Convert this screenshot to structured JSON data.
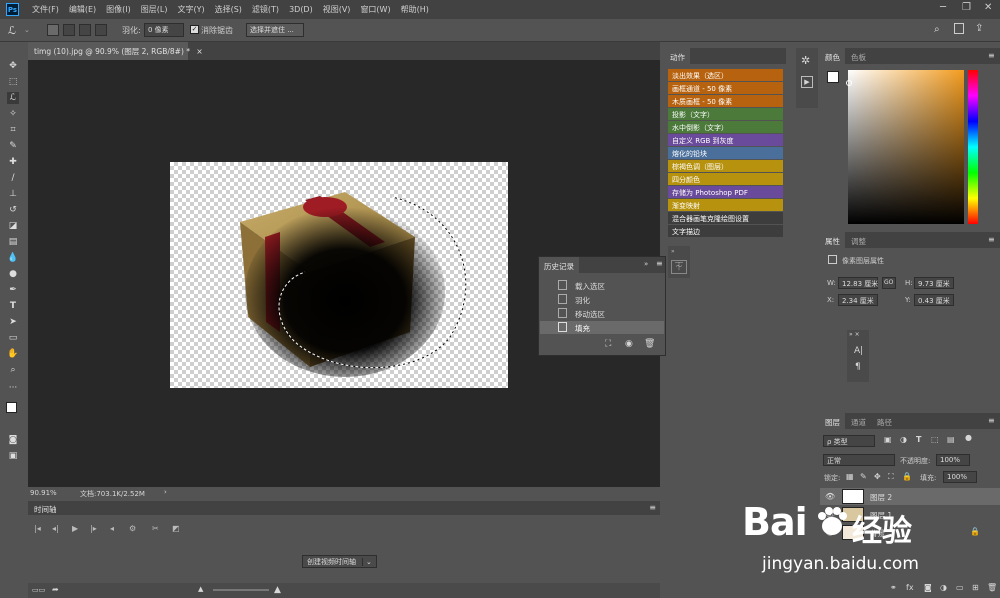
{
  "menubar": {
    "logo": "Ps",
    "items": [
      "文件(F)",
      "编辑(E)",
      "图像(I)",
      "图层(L)",
      "文字(Y)",
      "选择(S)",
      "滤镜(T)",
      "3D(D)",
      "视图(V)",
      "窗口(W)",
      "帮助(H)"
    ]
  },
  "options": {
    "feather_label": "羽化:",
    "feather_value": "0 像素",
    "antialias_label": "消除锯齿",
    "select_mask_button": "选择并遮住 ..."
  },
  "document": {
    "tab_title": "timg (10).jpg @ 90.9% (图层 2, RGB/8#) *",
    "zoom": "90.91%",
    "doc_info": "文档:703.1K/2.52M"
  },
  "timeline": {
    "title": "时间轴",
    "create_button": "创建视频时间轴"
  },
  "actions_panel": {
    "tab": "动作",
    "items": [
      {
        "label": "淡出效果（选区）",
        "color": "#b7620e"
      },
      {
        "label": "画框通道 - 50 像素",
        "color": "#b7620e"
      },
      {
        "label": "木质画框 - 50 像素",
        "color": "#b7620e"
      },
      {
        "label": "投影（文字）",
        "color": "#4b7a3a"
      },
      {
        "label": "水中倒影（文字）",
        "color": "#4b7a3a"
      },
      {
        "label": "自定义 RGB 到灰度",
        "color": "#6a4a9a"
      },
      {
        "label": "熔化的铅块",
        "color": "#4a6f9a"
      },
      {
        "label": "棕褐色调（图层）",
        "color": "#b7920e"
      },
      {
        "label": "四分颜色",
        "color": "#b7920e"
      },
      {
        "label": "存储为 Photoshop PDF",
        "color": "#6a4a9a"
      },
      {
        "label": "渐变映射",
        "color": "#b7920e"
      },
      {
        "label": "混合器画笔克隆绘图设置",
        "color": "#3d3d3d"
      },
      {
        "label": "文字描边",
        "color": "#3d3d3d"
      }
    ]
  },
  "history_panel": {
    "title": "历史记录",
    "items": [
      "载入选区",
      "羽化",
      "移动选区",
      "填充"
    ]
  },
  "color_panel": {
    "tabs": [
      "颜色",
      "色板"
    ]
  },
  "properties_panel": {
    "tabs": [
      "属性",
      "调整"
    ],
    "subtitle": "像素图层属性",
    "w_label": "W:",
    "w_value": "12.83 厘米",
    "h_label": "H:",
    "h_value": "9.73 厘米",
    "x_label": "X:",
    "x_value": "2.34 厘米",
    "y_label": "Y:",
    "y_value": "0.43 厘米",
    "go_label": "GO"
  },
  "char_panel": {
    "a_label": "A|",
    "p_label": "¶"
  },
  "layers_panel": {
    "tabs": [
      "图层",
      "通道",
      "路径"
    ],
    "kind_label": "ρ 类型",
    "blend_mode": "正常",
    "opacity_label": "不透明度:",
    "opacity_value": "100%",
    "lock_label": "锁定:",
    "fill_label": "填充:",
    "fill_value": "100%",
    "layers": [
      "图层 2",
      "图层 1",
      "背景"
    ]
  },
  "watermark": {
    "brand_left": "Bai",
    "brand_right": "经验",
    "url": "jingyan.baidu.com"
  },
  "colors": {
    "accent": "#31a8ff",
    "chrome_dark": "#424242",
    "chrome": "#535353",
    "workspace": "#282828"
  }
}
